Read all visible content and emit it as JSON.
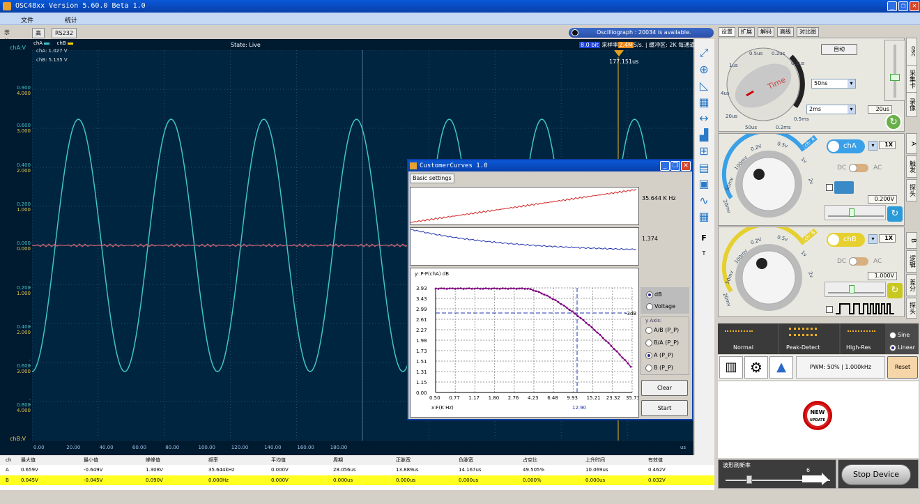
{
  "window": {
    "title": "OSC48xx  Version 5.60.0 Beta 1.0"
  },
  "menu": [
    "文件",
    "统计"
  ],
  "scope_tabs": [
    "示波器",
    "高级",
    "RS232"
  ],
  "notice": "Oscilliograph : 20034 is available.",
  "scope": {
    "cha_axis_label": "chA:V",
    "chb_axis_label": "chB:V",
    "legend_cha": "chA",
    "legend_chb": "chB",
    "cha_value": "chA: 1.027 V",
    "chb_value": "chB: 5.135 V",
    "state": "State: Live",
    "bits": "8.0 bit",
    "rate_prefix": "采样率",
    "rate_value": "2.4M",
    "rate_suffix": "S/s. | 缓冲区: 2K 每通道",
    "cursor_time": "177.151us",
    "y_ticks_a": [
      "0.900",
      "0.600",
      "0.400",
      "0.200",
      "0.000",
      "- 0.200",
      "- 0.400",
      "- 0.600",
      "- 0.800"
    ],
    "y_ticks_b": [
      "4.000",
      "3.000",
      "2.000",
      "1.000",
      "0.000",
      "- 1.000",
      "- 2.000",
      "- 3.000",
      "- 4.000"
    ],
    "x_ticks": [
      "0.00",
      "20.00",
      "40.00",
      "60.00",
      "80.00",
      "100.00",
      "120.00",
      "140.00",
      "160.00",
      "180.00"
    ],
    "x_unit": "us",
    "colors": {
      "cha": "#3fc4c8",
      "chb": "#ffd400",
      "ref": "#d05a6a",
      "cursor": "#c89a2a",
      "grid": "#2a4f6e"
    }
  },
  "tools": [
    "zoom-fit-icon",
    "zoom-in-icon",
    "ruler-icon",
    "grid-icon",
    "measure-horizontal-icon",
    "spectrum-icon",
    "calculator-icon",
    "save-icon",
    "image-icon",
    "wave-icon",
    "table-icon"
  ],
  "tool_letters": [
    "F",
    "T"
  ],
  "measurements": {
    "headers": [
      "ch",
      "最大值",
      "最小值",
      "峰峰值",
      "频率",
      "平均值",
      "周期",
      "正脉宽",
      "负脉宽",
      "占空比",
      "上升时间",
      "有效值"
    ],
    "rows": [
      [
        "A",
        "0.659V",
        "-0.649V",
        "1.308V",
        "35.644kHz",
        "0.000V",
        "28.056us",
        "13.889us",
        "14.167us",
        "49.505%",
        "10.069us",
        "0.462V"
      ],
      [
        "B",
        "0.045V",
        "-0.045V",
        "0.090V",
        "0.000Hz",
        "0.000V",
        "0.000us",
        "0.000us",
        "0.000us",
        "0.000%",
        "0.000us",
        "0.032V"
      ]
    ]
  },
  "customer_curves": {
    "title": "CustomerCurves 1.0",
    "tab": "Basic settings",
    "freq_readout": "35.644 K Hz",
    "ratio_readout": "1.374",
    "graph_title": "y: P-P(chA) dB",
    "y_ticks": [
      "3.93",
      "3.43",
      "2.99",
      "2.61",
      "2.27",
      "1.98",
      "1.73",
      "1.51",
      "1.31",
      "1.15",
      "0.00"
    ],
    "x_ticks": [
      "0.50",
      "0.77",
      "1.17",
      "1.80",
      "2.76",
      "4.23",
      "6.48",
      "9.93",
      "15.21",
      "23.32",
      "35.73"
    ],
    "x_label": "x:F(K Hz)",
    "marker_label": "-3dB",
    "cutoff_value": "12.90",
    "scale_options": [
      "dB",
      "Voltage"
    ],
    "scale_selected": "dB",
    "y_axis_label": "y Axis:",
    "y_axis_options": [
      "A/B (P_P)",
      "B/A (P_P)",
      "A (P_P)",
      "B (P_P)"
    ],
    "y_axis_selected": "A (P_P)",
    "clear_label": "Clear",
    "start_label": "Start"
  },
  "right_tabs": [
    "设置",
    "扩展",
    "解码",
    "高级",
    "对比图"
  ],
  "timebase": {
    "auto_label": "自动",
    "osc_label": "osc",
    "dial_label": "Time",
    "dial_ticks": [
      "1us",
      "0.5us",
      "0.2us",
      "0.1us",
      "4us",
      "20us",
      "50us",
      "0.2ms",
      "0.5ms"
    ],
    "sel1": "50ns",
    "sel2": "2ms",
    "value": "20us",
    "side_tabs": [
      "采集卡",
      "录像"
    ]
  },
  "chA": {
    "button": "chA",
    "tag": "ch: A",
    "probe": "1X",
    "dc": "DC",
    "ac": "AC",
    "value": "0.200V",
    "side_tabs": [
      "A",
      "触发",
      "探头"
    ],
    "dial_ticks": [
      "20mv",
      "50mv",
      "100mv",
      "0.2V",
      "0.5v",
      "1v",
      "2v"
    ]
  },
  "chB": {
    "button": "chB",
    "tag": "ch: B",
    "probe": "1X",
    "dc": "DC",
    "ac": "AC",
    "value": "1.000V",
    "side_tabs": [
      "B",
      "逻辑",
      "差分",
      "探头"
    ],
    "dial_ticks": [
      "20mv",
      "50mv",
      "100mv",
      "0.2V",
      "0.5v",
      "1v",
      "2v"
    ]
  },
  "acq": {
    "normal": "Normal",
    "peak": "Peak-Detect",
    "highres": "High-Res",
    "sine": "Sine",
    "linear": "Linear",
    "pwm": "PWM: 50% | 1.000kHz",
    "reset": "Reset"
  },
  "badge": {
    "line1": "NEW",
    "line2": "UPDATE"
  },
  "refresh": {
    "label": "波形刷新率",
    "value": "6"
  },
  "stop_label": "Stop Device"
}
